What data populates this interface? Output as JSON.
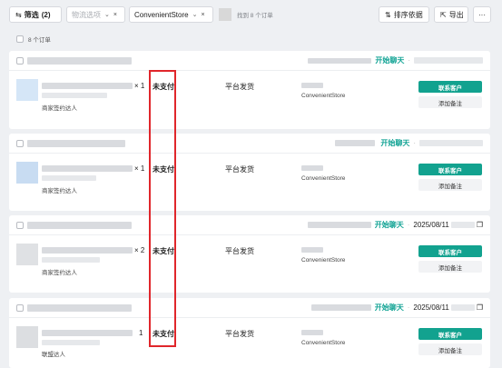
{
  "toolbar": {
    "filter_label": "筛选",
    "filter_count": "(2)",
    "logistics_placeholder": "物流选项",
    "store_filter_value": "ConvenientStore",
    "found_text": "找到 8 个订单",
    "sort_label": "排序依据",
    "export_label": "导出",
    "more_label": "···"
  },
  "list": {
    "count_text": "8 个订单"
  },
  "orders": [
    {
      "quantity": "× 1",
      "payment_status": "未支付",
      "shipping": "平台发货",
      "store": "ConvenientStore",
      "tag": "商家签约达人",
      "chat_label": "开始聊天",
      "date": "",
      "contact_label": "联系客户",
      "note_label": "添加备注"
    },
    {
      "quantity": "× 1",
      "payment_status": "未支付",
      "shipping": "平台发货",
      "store": "ConvenientStore",
      "tag": "商家签约达人",
      "chat_label": "开始聊天",
      "date": "",
      "contact_label": "联系客户",
      "note_label": "添加备注"
    },
    {
      "quantity": "× 2",
      "payment_status": "未支付",
      "shipping": "平台发货",
      "store": "ConvenientStore",
      "tag": "商家签约达人",
      "chat_label": "开始聊天",
      "date": "2025/08/11",
      "contact_label": "联系客户",
      "note_label": "添加备注"
    },
    {
      "quantity": "1",
      "payment_status": "未支付",
      "shipping": "平台发货",
      "store": "ConvenientStore",
      "tag": "联盟达人",
      "chat_label": "开始聊天",
      "date": "2025/08/11",
      "contact_label": "联系客户",
      "note_label": "添加备注"
    }
  ],
  "colors": {
    "accent": "#12a28f",
    "link": "#11a394",
    "highlight": "#e0262b",
    "page_bg": "#eef0f3"
  }
}
